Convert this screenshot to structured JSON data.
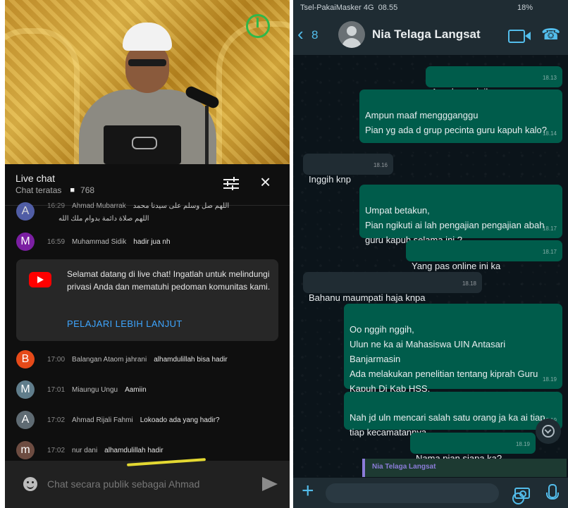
{
  "live_chat": {
    "title": "Live chat",
    "mode": "Chat teratas",
    "viewers": "768",
    "messages": [
      {
        "avatar": "A",
        "color": "#5c6bc0",
        "time": "16:29",
        "author": "Ahmad Mubarrak",
        "text": "اللهم صل وسلم على سيدنا محمد",
        "text2": "اللهم صلاة دائمة بدوام ملك الله"
      },
      {
        "avatar": "M",
        "color": "#7b1fa2",
        "time": "16:59",
        "author": "Muhammad Sidik",
        "text": "hadir jua nh"
      },
      {
        "avatar": "B",
        "color": "#e64a19",
        "time": "17:00",
        "author": "Balangan Ataom jahrani",
        "text": "alhamdulillah bisa hadir"
      },
      {
        "avatar": "M",
        "color": "#607d8b",
        "time": "17:01",
        "author": "Miaungu Ungu",
        "text": "Aamiin"
      },
      {
        "avatar": "A",
        "color": "#5f6b73",
        "time": "17:02",
        "author": "Ahmad Rijali Fahmi",
        "text": "Lokoado ada yang hadir?"
      },
      {
        "avatar": "m",
        "color": "#6d4c41",
        "time": "17:02",
        "author": "nur dani",
        "text": "alhamdulillah hadir"
      }
    ],
    "welcome_text": "Selamat datang di live chat! Ingatlah untuk melindungi privasi Anda dan mematuhi pedoman komunitas kami.",
    "welcome_link": "PELAJARI LEBIH LANJUT",
    "composer_placeholder": "Chat secara publik sebagai Ahmad"
  },
  "whatsapp": {
    "carrier": "Tsel-PakaiMasker  4G",
    "time": "08.55",
    "battery": "18%",
    "back_count": "8",
    "contact": "Nia Telaga Langsat",
    "messages": [
      {
        "dir": "out",
        "text": "Assalamualaikum",
        "time": "18.13"
      },
      {
        "dir": "out",
        "text": "Ampun maaf menggganggu\nPian yg ada d grup pecinta guru kapuh kalo?",
        "time": "18.14"
      },
      {
        "dir": "in",
        "text": "Inggih knp",
        "time": "18.16"
      },
      {
        "dir": "out",
        "text": "Umpat betakun,\nPian ngikuti ai lah pengajian pengajian abah guru kapuh selama ini ?",
        "time": "18.17"
      },
      {
        "dir": "out",
        "text": "Yang pas online ini ka",
        "time": "18.17"
      },
      {
        "dir": "in",
        "text": "Bahanu maumpati haja knpa",
        "time": "18.18"
      },
      {
        "dir": "out",
        "text": "Oo nggih nggih,\nUlun ne ka ai Mahasiswa UIN Antasari Banjarmasin\nAda melakukan penelitian tentang kiprah Guru Kapuh Di Kab HSS,",
        "time": "18.19"
      },
      {
        "dir": "out",
        "text": "Nah jd uln mencari salah satu orang ja ka ai tiap tiap kecamatannya",
        "time": "18.19"
      },
      {
        "dir": "out",
        "text": "Nama pian siapa ka?",
        "time": "18.19"
      }
    ],
    "reply_preview": "Nia Telaga Langsat"
  }
}
